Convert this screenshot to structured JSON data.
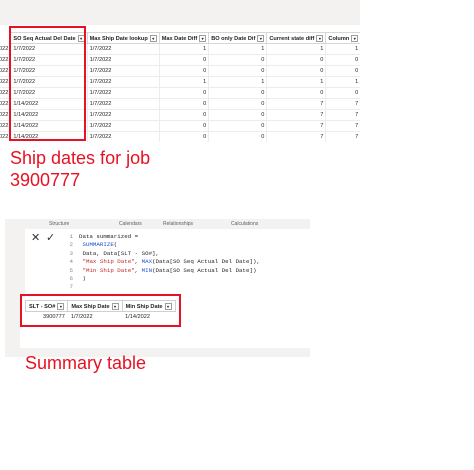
{
  "grid": {
    "columns": [
      "SO Seq Actual Del Date",
      "Max Ship Date lookup",
      "Max Date Diff",
      "BO only Date Dif",
      "Current state diff",
      "Column"
    ],
    "row_prefix": "022",
    "rows": [
      [
        "1/7/2022",
        "1/7/2022",
        "1",
        "1",
        "1",
        "1"
      ],
      [
        "1/7/2022",
        "1/7/2022",
        "0",
        "0",
        "0",
        "0"
      ],
      [
        "1/7/2022",
        "1/7/2022",
        "0",
        "0",
        "0",
        "0"
      ],
      [
        "1/7/2022",
        "1/7/2022",
        "1",
        "1",
        "1",
        "1"
      ],
      [
        "1/7/2022",
        "1/7/2022",
        "0",
        "0",
        "0",
        "0"
      ],
      [
        "1/14/2022",
        "1/7/2022",
        "0",
        "0",
        "7",
        "7"
      ],
      [
        "1/14/2022",
        "1/7/2022",
        "0",
        "0",
        "7",
        "7"
      ],
      [
        "1/14/2022",
        "1/7/2022",
        "0",
        "0",
        "7",
        "7"
      ],
      [
        "1/14/2022",
        "1/7/2022",
        "0",
        "0",
        "7",
        "7"
      ]
    ]
  },
  "caption_ship": "Ship dates for job\n3900777",
  "caption_ship_line1": "Ship dates for job",
  "caption_ship_line2": "3900777",
  "tabs": [
    "Structure",
    "Calendars",
    "Relationships",
    "Calculations"
  ],
  "editor": {
    "cancel_icon": "close-icon",
    "confirm_icon": "check-icon",
    "lines": [
      {
        "n": "1",
        "text": "Data summarized ="
      },
      {
        "n": "2",
        "text": "    SUMMARIZE("
      },
      {
        "n": "3",
        "text": "        Data, Data[SLT - SO#],"
      },
      {
        "n": "4",
        "text": "        \"Max Ship Date\", MAX(Data[SO Seq Actual Del Date]),"
      },
      {
        "n": "5",
        "text": "        \"Min Ship Date\", MIN(Data[SO Seq Actual Del Date])"
      },
      {
        "n": "6",
        "text": "        )"
      },
      {
        "n": "7",
        "text": ""
      }
    ]
  },
  "summary": {
    "columns": [
      "SLT - SO#",
      "Max Ship Date",
      "Min Ship Date"
    ],
    "row": [
      "3900777",
      "1/7/2022",
      "1/14/2022"
    ]
  },
  "caption_summary": "Summary table",
  "colors": {
    "highlight": "#e81123",
    "keyword": "#1a4fd6",
    "string": "#c4262e"
  }
}
